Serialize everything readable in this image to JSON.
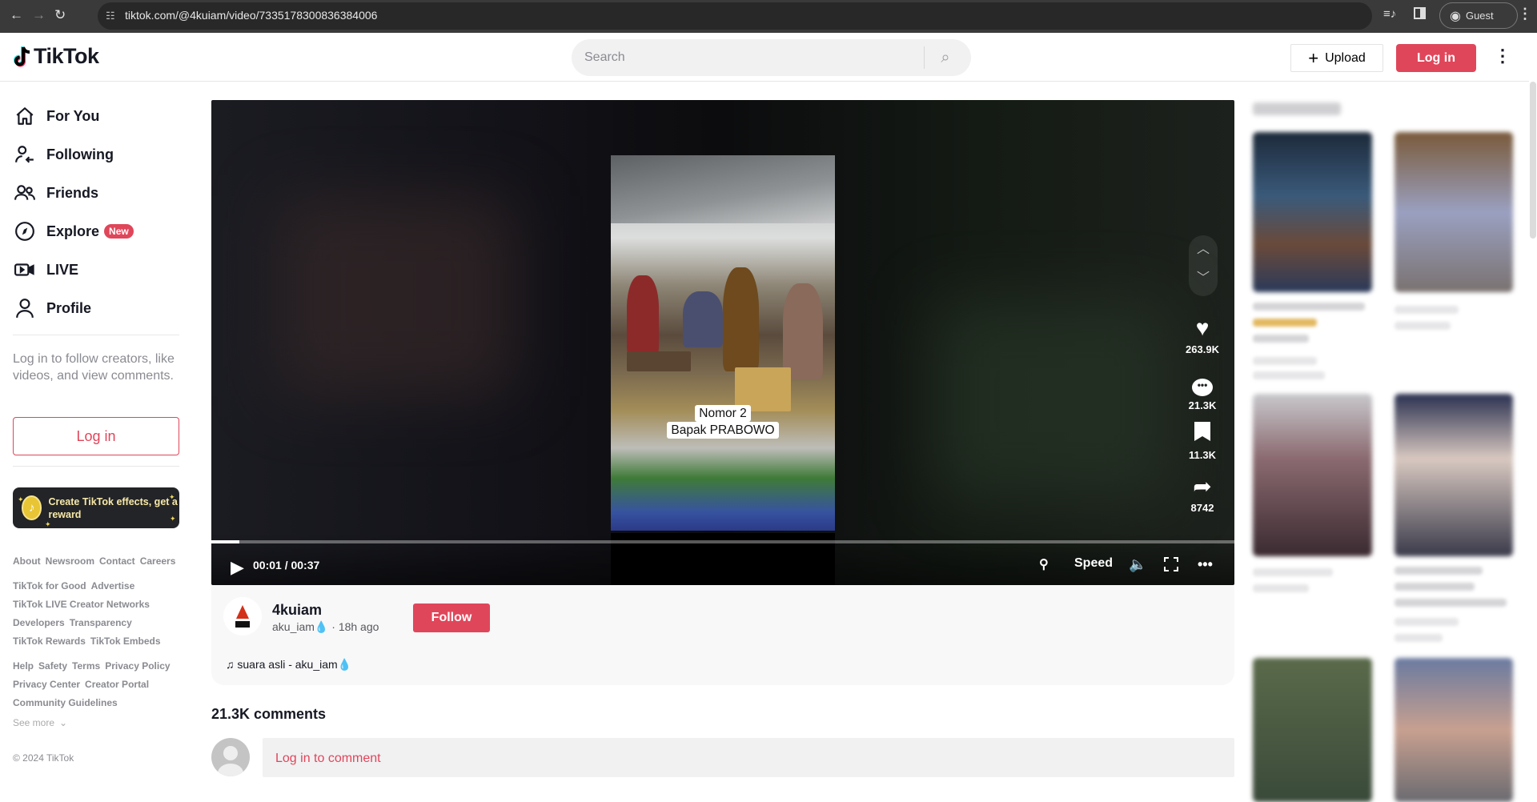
{
  "browser": {
    "url": "tiktok.com/@4kuiam/video/7335178300836384006",
    "profile_label": "Guest"
  },
  "header": {
    "logo_text": "TikTok",
    "search_placeholder": "Search",
    "upload_label": "Upload",
    "login_label": "Log in"
  },
  "sidebar": {
    "items": [
      {
        "label": "For You",
        "icon": "home-icon"
      },
      {
        "label": "Following",
        "icon": "following-icon"
      },
      {
        "label": "Friends",
        "icon": "friends-icon"
      },
      {
        "label": "Explore",
        "icon": "compass-icon",
        "badge": "New"
      },
      {
        "label": "LIVE",
        "icon": "live-camera-icon"
      },
      {
        "label": "Profile",
        "icon": "profile-icon"
      }
    ],
    "login_prompt": "Log in to follow creators, like videos, and view comments.",
    "login_label": "Log in",
    "banner_text": "Create TikTok effects, get a reward",
    "footer_rows": [
      [
        "About",
        "Newsroom",
        "Contact",
        "Careers"
      ],
      [
        "TikTok for Good",
        "Advertise"
      ],
      [
        "TikTok LIVE Creator Networks"
      ],
      [
        "Developers",
        "Transparency"
      ],
      [
        "TikTok Rewards",
        "TikTok Embeds"
      ],
      [
        "Help",
        "Safety",
        "Terms",
        "Privacy Policy"
      ],
      [
        "Privacy Center",
        "Creator Portal"
      ],
      [
        "Community Guidelines"
      ]
    ],
    "see_more": "See more",
    "copyright": "© 2024 TikTok"
  },
  "video": {
    "caption_line1": "Nomor 2",
    "caption_line2": "Bapak PRABOWO",
    "time": "00:01 / 00:37",
    "progress_fraction": 0.027,
    "speed_label": "Speed",
    "likes": "263.9K",
    "comments": "21.3K",
    "saves": "11.3K",
    "shares": "8742"
  },
  "author": {
    "name": "4kuiam",
    "handle": "aku_iam💧",
    "posted": "18h ago",
    "follow_label": "Follow",
    "music": "suara asli - aku_iam💧"
  },
  "comments": {
    "count_label": "21.3K comments",
    "login_prompt": "Log in to comment"
  },
  "colors": {
    "accent": "#e0465a",
    "text": "#161823",
    "muted": "#8a8b91"
  }
}
